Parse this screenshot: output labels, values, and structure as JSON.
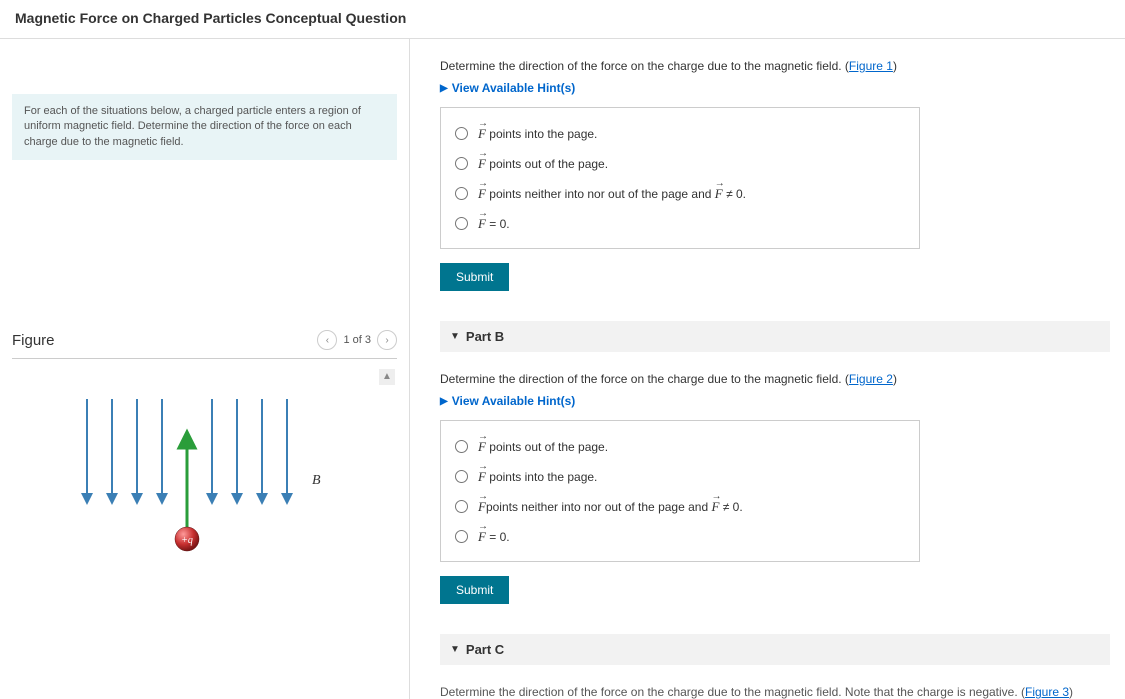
{
  "page_title": "Magnetic Force on Charged Particles Conceptual Question",
  "intro_text": "For each of the situations below, a charged particle enters a region of uniform magnetic field. Determine the direction of the force on each charge due to the magnetic field.",
  "figure": {
    "title": "Figure",
    "counter": "1 of 3",
    "b_label": "B",
    "q_label": "+q"
  },
  "partA": {
    "prompt_pre": "Determine the direction of the force on the charge due to the magnetic field. (",
    "prompt_link": "Figure 1",
    "prompt_post": ")",
    "hints_label": "View Available Hint(s)",
    "options": {
      "o1_suffix": " points into the page.",
      "o2_suffix": " points out of the page.",
      "o3_suffix": " points neither into nor out of the page and ",
      "o3_tail": " ≠ 0.",
      "o4_tail": " = 0."
    },
    "submit": "Submit"
  },
  "partB": {
    "header": "Part B",
    "prompt_pre": "Determine the direction of the force on the charge due to the magnetic field. (",
    "prompt_link": "Figure 2",
    "prompt_post": ")",
    "hints_label": "View Available Hint(s)",
    "options": {
      "o1_suffix": " points out of the page.",
      "o2_suffix": " points into the page.",
      "o3_suffix": "points neither into nor out of the page and ",
      "o3_tail": " ≠ 0.",
      "o4_tail": " = 0."
    },
    "submit": "Submit"
  },
  "partC": {
    "header": "Part C",
    "cutoff_pre": "Determine the direction of the force on the charge due to the magnetic field. Note that the charge is negative. (",
    "cutoff_link": "Figure 3",
    "cutoff_post": ")"
  }
}
